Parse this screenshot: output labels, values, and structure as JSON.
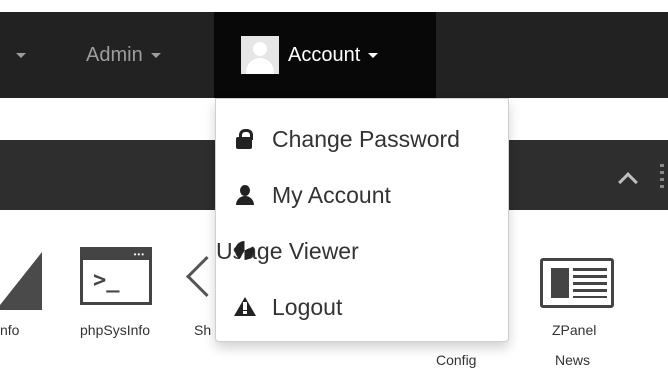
{
  "navbar": {
    "admin_label": "Admin",
    "account_label": "Account",
    "bg_color": "#222222",
    "active_bg_color": "#080808"
  },
  "dropdown": {
    "items": [
      {
        "label": "Change Password",
        "icon": "lock-icon"
      },
      {
        "label": "My Account",
        "icon": "user-icon"
      },
      {
        "label": "Usage Viewer",
        "icon": "pie-chart-icon"
      },
      {
        "label": "Logout",
        "icon": "warning-icon"
      }
    ]
  },
  "modules": {
    "items": [
      {
        "label": "nfo"
      },
      {
        "label": "phpSysInfo"
      },
      {
        "label": "Sh"
      },
      {
        "label": "Config"
      },
      {
        "label": "ZPanel"
      },
      {
        "label": "News"
      }
    ]
  }
}
